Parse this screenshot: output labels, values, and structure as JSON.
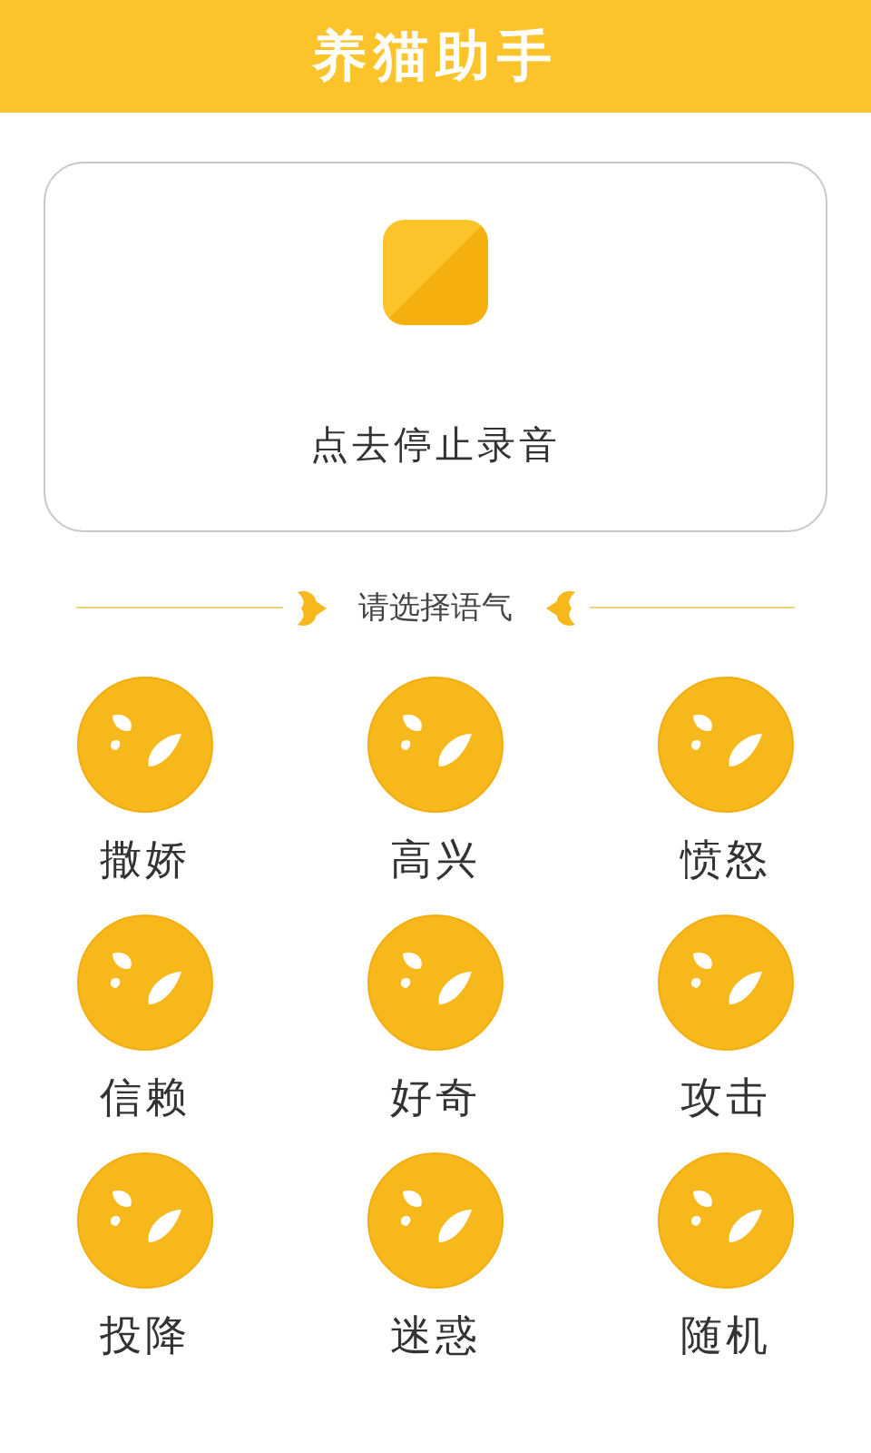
{
  "header": {
    "title": "养猫助手"
  },
  "record_card": {
    "label": "点去停止录音"
  },
  "section": {
    "title": "请选择语气"
  },
  "moods": [
    {
      "label": "撒娇"
    },
    {
      "label": "高兴"
    },
    {
      "label": "愤怒"
    },
    {
      "label": "信赖"
    },
    {
      "label": "好奇"
    },
    {
      "label": "攻击"
    },
    {
      "label": "投降"
    },
    {
      "label": "迷惑"
    },
    {
      "label": "随机"
    }
  ]
}
